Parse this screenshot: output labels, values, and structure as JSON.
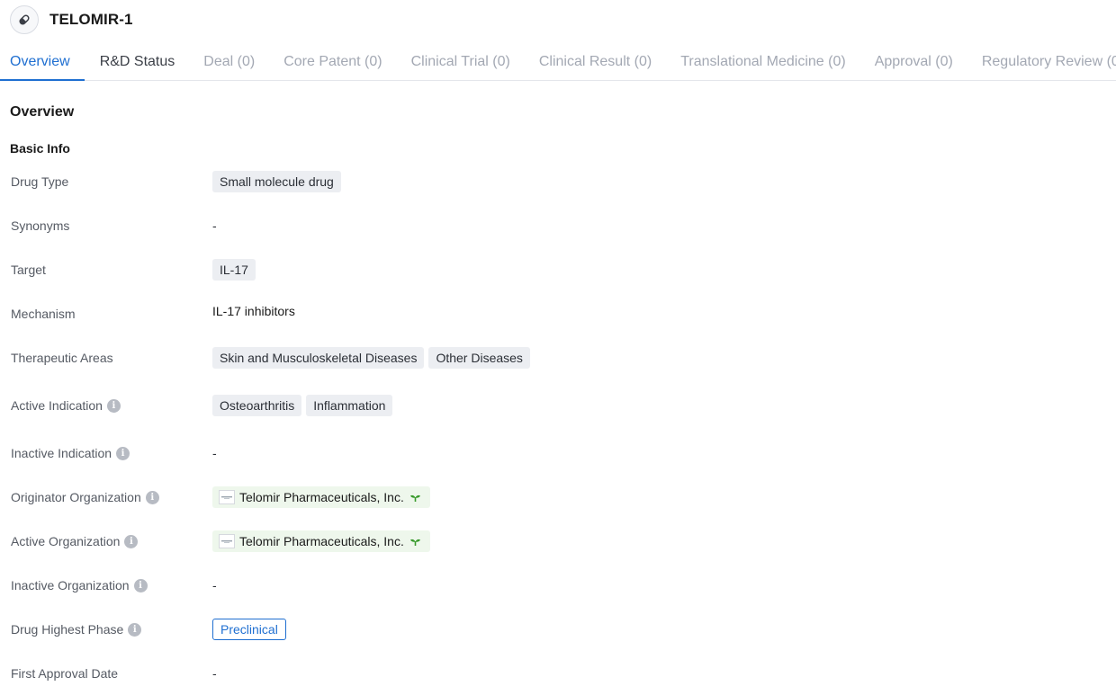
{
  "header": {
    "title": "TELOMIR-1",
    "icon": "pill-icon"
  },
  "tabs": [
    {
      "label": "Overview",
      "state": "active"
    },
    {
      "label": "R&D Status",
      "state": "dark"
    },
    {
      "label": "Deal (0)",
      "state": "disabled"
    },
    {
      "label": "Core Patent (0)",
      "state": "disabled"
    },
    {
      "label": "Clinical Trial (0)",
      "state": "disabled"
    },
    {
      "label": "Clinical Result (0)",
      "state": "disabled"
    },
    {
      "label": "Translational Medicine (0)",
      "state": "disabled"
    },
    {
      "label": "Approval (0)",
      "state": "disabled"
    },
    {
      "label": "Regulatory Review (0)",
      "state": "disabled"
    }
  ],
  "overview": {
    "title": "Overview",
    "basic_info_title": "Basic Info",
    "drug_type": {
      "label": "Drug Type",
      "chips": [
        "Small molecule drug"
      ]
    },
    "synonyms": {
      "label": "Synonyms",
      "value": "-"
    },
    "target": {
      "label": "Target",
      "chips": [
        "IL-17"
      ]
    },
    "mechanism": {
      "label": "Mechanism",
      "value": "IL-17 inhibitors"
    },
    "therapeutic_areas": {
      "label": "Therapeutic Areas",
      "chips": [
        "Skin and Musculoskeletal Diseases",
        "Other Diseases"
      ]
    },
    "active_indication": {
      "label": "Active Indication",
      "chips": [
        "Osteoarthritis",
        "Inflammation"
      ]
    },
    "inactive_indication": {
      "label": "Inactive Indication",
      "value": "-"
    },
    "originator_organization": {
      "label": "Originator Organization",
      "org": "Telomir Pharmaceuticals, Inc."
    },
    "active_organization": {
      "label": "Active Organization",
      "org": "Telomir Pharmaceuticals, Inc."
    },
    "inactive_organization": {
      "label": "Inactive Organization",
      "value": "-"
    },
    "drug_highest_phase": {
      "label": "Drug Highest Phase",
      "value": "Preclinical"
    },
    "first_approval_date": {
      "label": "First Approval Date",
      "value": "-"
    }
  },
  "colors": {
    "accent": "#1f6fd1",
    "chip_bg": "#eceef2",
    "org_chip_bg": "#eef7ec",
    "sprout": "#3a9b2e"
  }
}
